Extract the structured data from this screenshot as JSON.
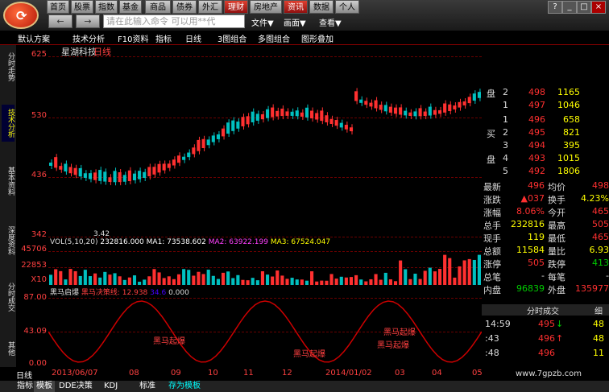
{
  "topbar": {
    "row1": [
      "首页",
      "股票",
      "指数",
      "基金",
      "商品",
      "债券",
      "外汇",
      "理财",
      "房地产",
      "资讯",
      "数据",
      "个人"
    ],
    "cmd_placeholder": "请在此输入命令 可以用**代",
    "menus": [
      "文件▼",
      "画面▼",
      "查看▼"
    ],
    "win": [
      "?",
      "_",
      "□",
      "×"
    ]
  },
  "toolbar": [
    "默认方案",
    "技术分析",
    "F10资料",
    "指标",
    "日线",
    "3图组合",
    "多图组合",
    "图形叠加"
  ],
  "nav": [
    "分时走势",
    "技术分析",
    "基本资料",
    "深度资料",
    "分时成交",
    "其他"
  ],
  "chart": {
    "name": "星湖科技",
    "period": "日线",
    "y_main": [
      "625",
      "530",
      "436",
      "342"
    ],
    "low_label": "3.42",
    "vol_line": "VOL(5,10,20)",
    "vol_value": "232816.000",
    "ma1": "MA1: 73538.602",
    "ma2": "MA2: 63922.199",
    "ma3": "MA3: 67524.047",
    "y_vol": [
      "45706",
      "22853",
      "X10"
    ],
    "ind_title": "黑马启爆",
    "ind_sub": "黑马决策线: 12.938",
    "ind_v2": "34.6",
    "ind_v3": "0.000",
    "y_ind": [
      "87.00",
      "43.09",
      "0.00"
    ],
    "labels": [
      "黑马起爆",
      "黑马起爆",
      "黑马起爆",
      "黑马起爆"
    ],
    "xaxis": [
      "日线",
      "2013/06/07",
      "08",
      "09",
      "10",
      "11",
      "12",
      "2014/01/02",
      "03",
      "04",
      "05"
    ]
  },
  "chart_data": {
    "type": "candlestick",
    "title": "星湖科技 日线",
    "ylim": [
      342,
      625
    ],
    "y_ticks": [
      625,
      530,
      436,
      342
    ],
    "x_ticks": [
      "2013/06/07",
      "08",
      "09",
      "10",
      "11",
      "12",
      "2014/01/02",
      "03",
      "04",
      "05"
    ]
  },
  "quote": {
    "sell": [
      {
        "lab": "盘",
        "n": "2",
        "p": "498",
        "v": "1165"
      },
      {
        "lab": "",
        "n": "1",
        "p": "497",
        "v": "1046"
      }
    ],
    "buy": [
      {
        "lab": "",
        "n": "1",
        "p": "496",
        "v": "658"
      },
      {
        "lab": "买",
        "n": "2",
        "p": "495",
        "v": "821"
      },
      {
        "lab": "",
        "n": "3",
        "p": "494",
        "v": "395"
      },
      {
        "lab": "盘",
        "n": "4",
        "p": "493",
        "v": "1015"
      },
      {
        "lab": "",
        "n": "5",
        "p": "492",
        "v": "1806"
      }
    ],
    "info": [
      [
        "最新",
        "496",
        "均价",
        "498"
      ],
      [
        "涨跌",
        "▲037",
        "换手",
        "4.23%"
      ],
      [
        "涨幅",
        "8.06%",
        "今开",
        "465"
      ],
      [
        "总手",
        "232816",
        "最高",
        "505"
      ],
      [
        "现手",
        "119",
        "最低",
        "465"
      ],
      [
        "总额",
        "11584",
        "量比",
        "6.93"
      ],
      [
        "涨停",
        "505",
        "跌停",
        "413"
      ],
      [
        "总笔",
        "-",
        "每笔",
        "-"
      ],
      [
        "内盘",
        "96839",
        "外盘",
        "135977"
      ]
    ],
    "trades_title": "分时成交",
    "trades_tab": "细",
    "trades": [
      {
        "t": "14:59",
        "p": "495",
        "arrow": "↓",
        "v": "48"
      },
      {
        "t": ":43",
        "p": "496",
        "arrow": "↑",
        "v": "48"
      },
      {
        "t": ":48",
        "p": "496",
        "arrow": "",
        "v": "11"
      }
    ]
  },
  "bottom": {
    "tabs": [
      "指标",
      "模板",
      "DDE决策",
      "KDJ",
      "标准",
      "存为模板"
    ],
    "site": "www.7gpzb.com"
  },
  "colors": {
    "up": "#ff3030",
    "down": "#00c0c0",
    "grid": "#6a0000",
    "ma_white": "#ffffff",
    "ma_yellow": "#ffff00",
    "ma_purple": "#ff40ff"
  }
}
